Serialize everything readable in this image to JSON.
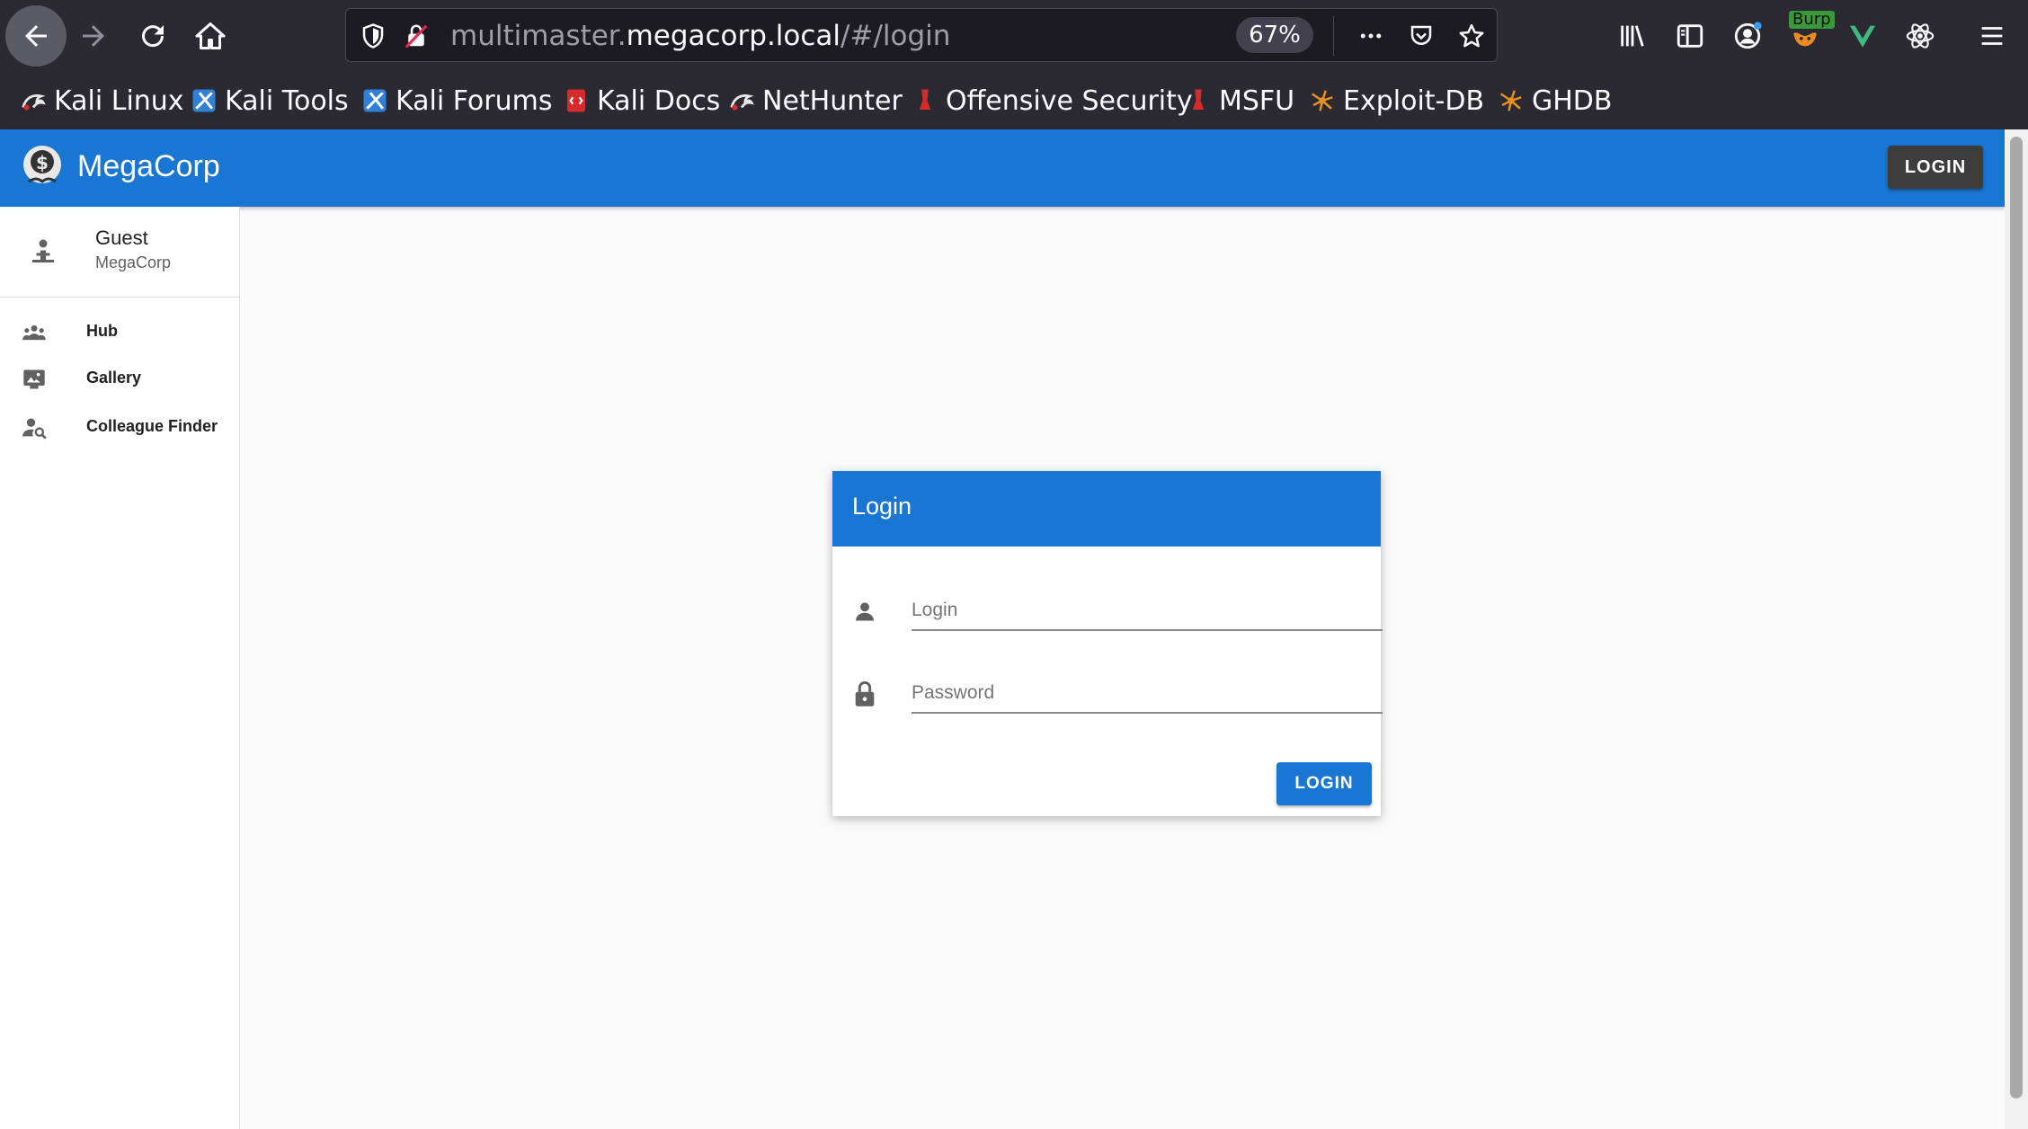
{
  "browser": {
    "url_prefix": "multimaster.",
    "url_host": "megacorp.local",
    "url_path": "/#/login",
    "zoom": "67%",
    "burp_label": "Burp",
    "bookmarks": [
      {
        "label": "Kali Linux"
      },
      {
        "label": "Kali Tools"
      },
      {
        "label": "Kali Forums"
      },
      {
        "label": "Kali Docs"
      },
      {
        "label": "NetHunter"
      },
      {
        "label": "Offensive Security"
      },
      {
        "label": "MSFU"
      },
      {
        "label": "Exploit-DB"
      },
      {
        "label": "GHDB"
      }
    ]
  },
  "app": {
    "brand": "MegaCorp",
    "header_login": "LOGIN",
    "colors": {
      "primary": "#1976d2",
      "dark_button": "#3c3c3c"
    }
  },
  "sidebar": {
    "user_name": "Guest",
    "user_org": "MegaCorp",
    "items": [
      {
        "label": "Hub",
        "icon": "people-icon"
      },
      {
        "label": "Gallery",
        "icon": "gallery-icon"
      },
      {
        "label": "Colleague Finder",
        "icon": "person-search-icon"
      }
    ]
  },
  "login_card": {
    "title": "Login",
    "login_placeholder": "Login",
    "password_placeholder": "Password",
    "button": "LOGIN"
  }
}
